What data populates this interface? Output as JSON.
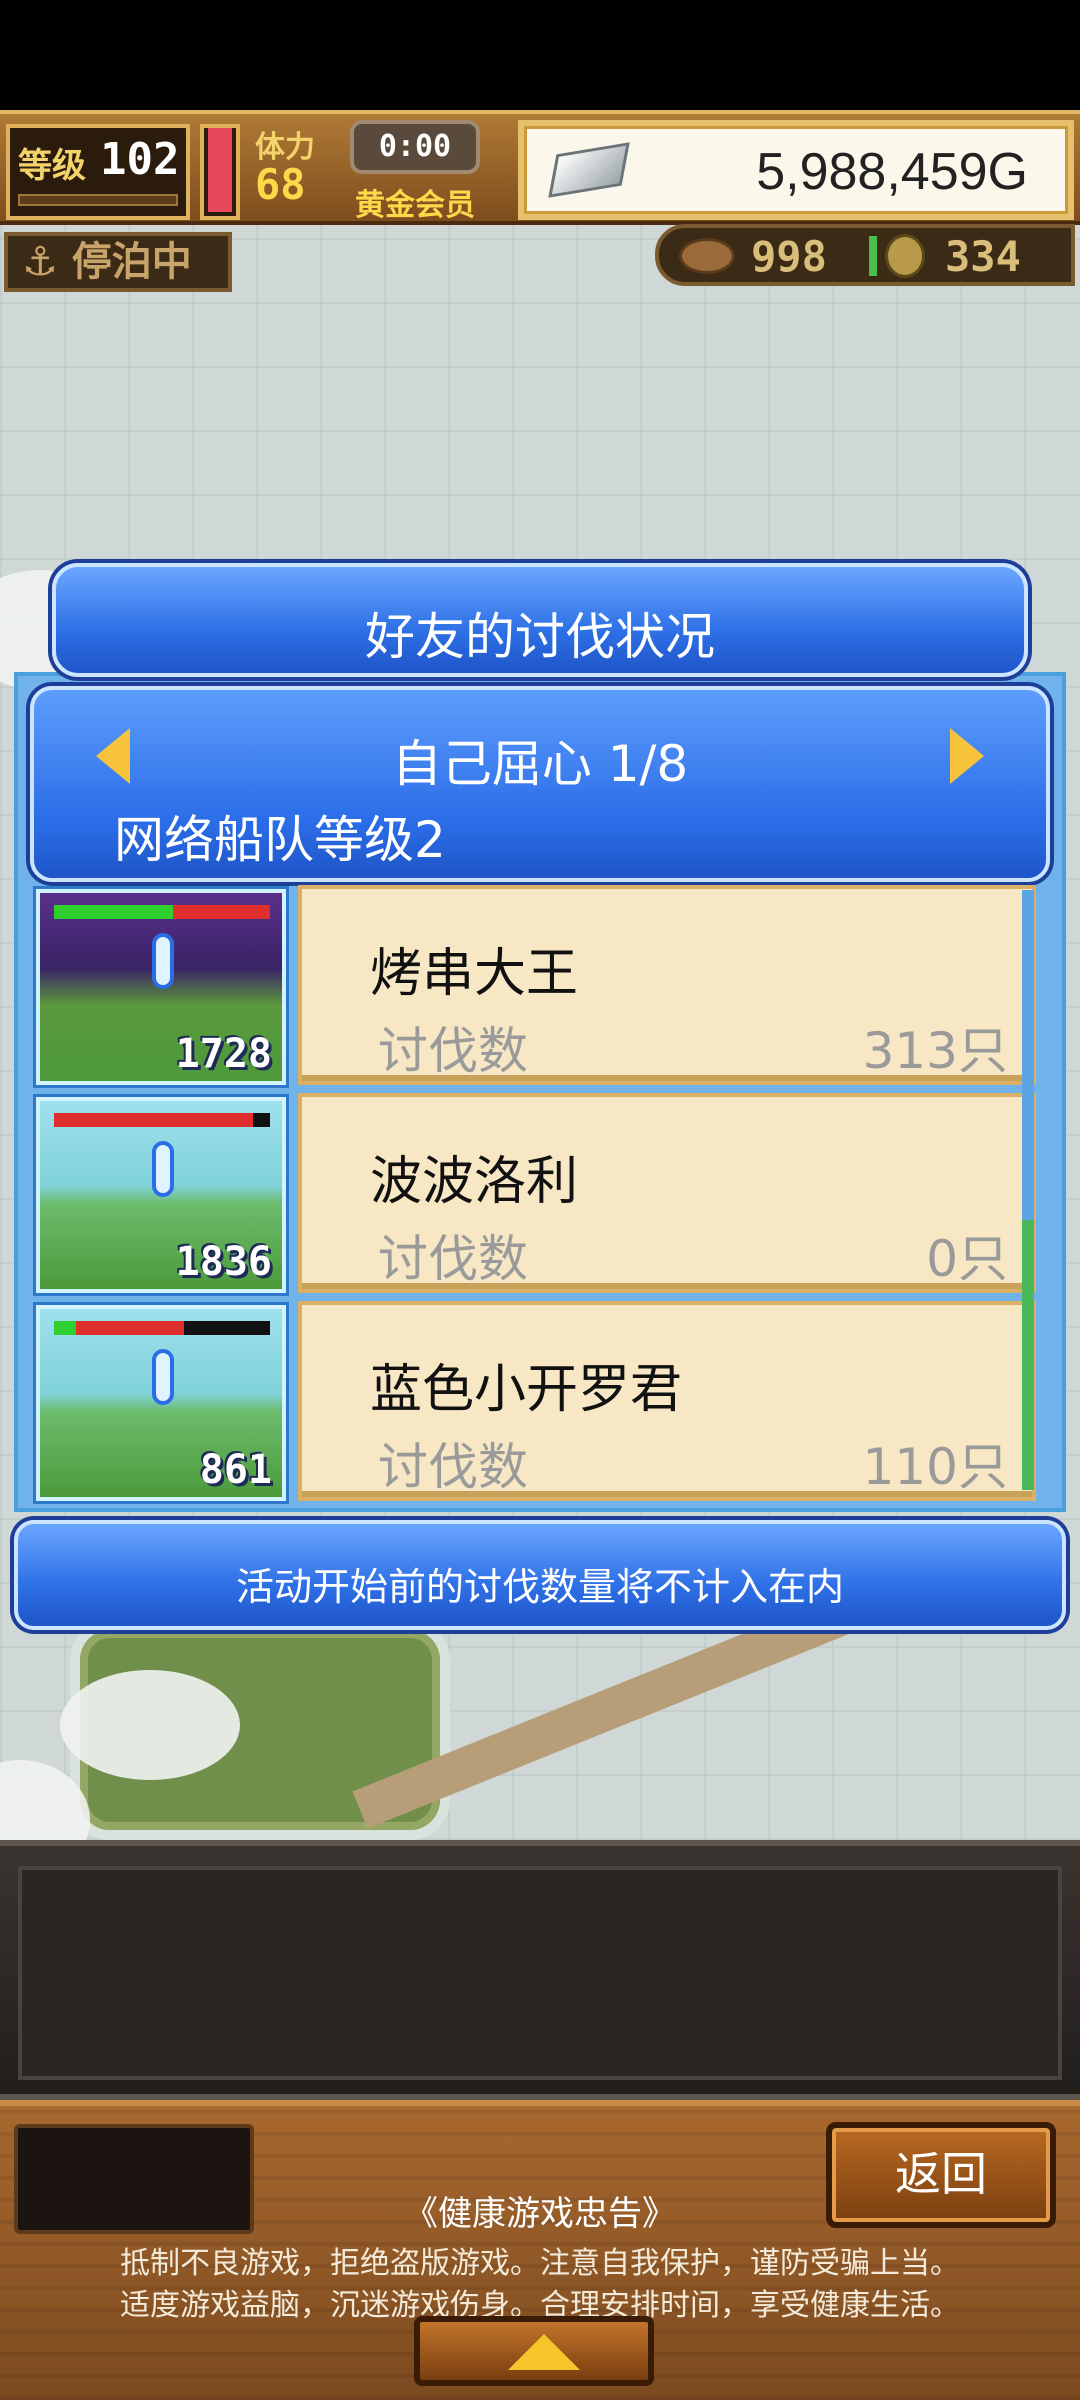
{
  "hud": {
    "level_label": "等级",
    "level_value": "102",
    "stamina_label": "体力",
    "stamina_value": "68",
    "stamina_fraction": 0.95,
    "timer": "0:00",
    "membership": "黄金会员",
    "gold": "5,988,459G",
    "dock_status": "停泊中",
    "resource1": "998",
    "resource2": "334"
  },
  "dialog": {
    "title": "好友的讨伐状况",
    "page_title": "自己屈心 1/8",
    "fleet_level": "网络船队等级2",
    "rows": [
      {
        "name": "烤串大王",
        "label": "讨伐数",
        "value": "313只",
        "thumb_num": "1728",
        "hp_fraction": 0.55
      },
      {
        "name": "波波洛利",
        "label": "讨伐数",
        "value": "0只",
        "thumb_num": "1836",
        "hp_fraction": 0.92
      },
      {
        "name": "蓝色小开罗君",
        "label": "讨伐数",
        "value": "110只",
        "thumb_num": "861",
        "hp_fraction": 0.5
      }
    ],
    "note": "活动开始前的讨伐数量将不计入在内"
  },
  "bottom": {
    "back_label": "返回",
    "health_title": "《健康游戏忠告》",
    "health_line1": "抵制不良游戏，拒绝盗版游戏。注意自我保护，谨防受骗上当。",
    "health_line2": "适度游戏益脑，沉迷游戏伤身。合理安排时间，享受健康生活。"
  }
}
